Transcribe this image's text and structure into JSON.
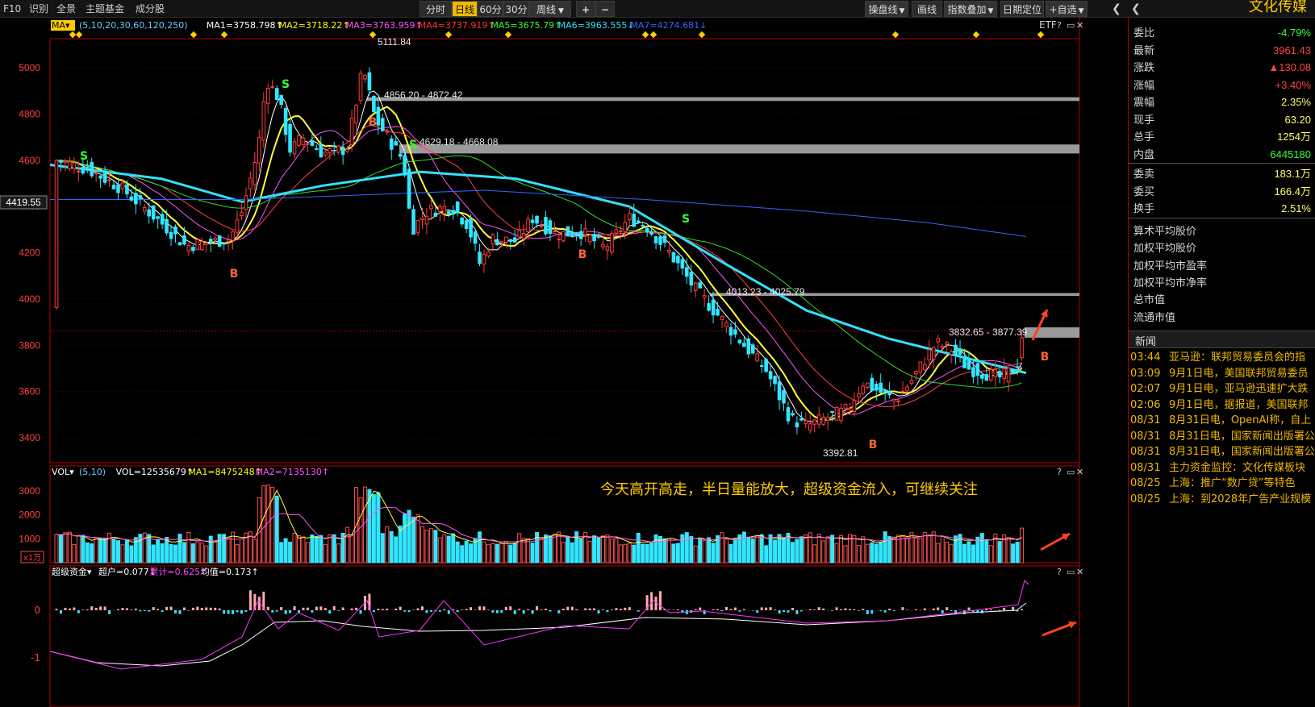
{
  "toolbar": {
    "left": [
      "F10",
      "识别",
      "全景",
      "主题基金",
      "成分股"
    ],
    "periods": [
      "分时",
      "日线",
      "60分",
      "30分",
      "周线"
    ],
    "active_period": "日线",
    "zoom_in": "+",
    "zoom_out": "−",
    "right": [
      "操盘线",
      "画线",
      "指数叠加",
      "日期定位",
      "+自选"
    ],
    "title": "文化传媒"
  },
  "indicator_bars": {
    "ma": {
      "name": "MA",
      "params": "(5,10,20,30,60,120,250)",
      "values": [
        {
          "text": "MA1=3758.798↑",
          "color": "#ffffff"
        },
        {
          "text": "MA2=3718.22↑",
          "color": "#ffff00"
        },
        {
          "text": "MA3=3763.959↑",
          "color": "#ff55ff"
        },
        {
          "text": "MA4=3737.919↑",
          "color": "#ff3333"
        },
        {
          "text": "MA5=3675.79↑",
          "color": "#33ff33"
        },
        {
          "text": "MA6=3963.555↓",
          "color": "#33ddff"
        },
        {
          "text": "MA7=4274.681↓",
          "color": "#3366ff"
        }
      ],
      "etf": "ETF"
    },
    "vol": {
      "name": "VOL",
      "params": "(5,10)",
      "values": [
        {
          "text": "VOL=12535679↑",
          "color": "#ffffff"
        },
        {
          "text": "MA1=8475248↑",
          "color": "#ffff00"
        },
        {
          "text": "MA2=7135130↑",
          "color": "#ff55ff"
        }
      ]
    },
    "fund": {
      "name": "超级资金",
      "values": [
        {
          "text": "超户=0.077↓",
          "color": "#ffffff"
        },
        {
          "text": "累计=0.625↑",
          "color": "#ff44ff"
        },
        {
          "text": "均值=0.173↑",
          "color": "#ffffff"
        }
      ]
    }
  },
  "chart_data": {
    "type": "candlestick",
    "y_axis_ticks": [
      5000,
      4800,
      4600,
      4400,
      4200,
      4000,
      3800,
      3600,
      3400
    ],
    "ylim": [
      3350,
      5200
    ],
    "current_price_label": "4419.55",
    "price_annotations": [
      {
        "text": "5111.84",
        "price": 5111.84
      },
      {
        "text": "4856.20 - 4872.42",
        "price": 4872.42
      },
      {
        "text": "4629.18 - 4668.08",
        "price": 4668.08
      },
      {
        "text": "4013.23 - 4025.79",
        "price": 4025.79
      },
      {
        "text": "3832.65 - 3877.39",
        "price": 3877.39
      },
      {
        "text": "3392.81",
        "price": 3392.81
      }
    ],
    "resistance_zones": [
      {
        "low": 4856.2,
        "high": 4872.42
      },
      {
        "low": 4629.18,
        "high": 4668.08
      },
      {
        "low": 4013.23,
        "high": 4025.79
      },
      {
        "low": 3832.65,
        "high": 3877.39
      }
    ],
    "signals": [
      "S",
      "B",
      "S",
      "B",
      "S",
      "B",
      "S",
      "B",
      "B"
    ],
    "vol_ticks": [
      3000,
      2000,
      1000
    ],
    "vol_unit": "x1万",
    "fund_ticks": [
      "0",
      "-1"
    ],
    "annotation_text": "今天高开高走，半日量能放大，超级资金流入，可继续关注"
  },
  "quote": {
    "rows": [
      {
        "label": "委比",
        "value": "-4.79%",
        "color": "#33ff33"
      },
      {
        "label": "最新",
        "value": "3961.43",
        "color": "#ff4444"
      },
      {
        "label": "涨跌",
        "value": "▲130.08",
        "color": "#ff4444"
      },
      {
        "label": "涨幅",
        "value": "+3.40%",
        "color": "#ff4444"
      },
      {
        "label": "震幅",
        "value": "2.35%",
        "color": "#ffff66"
      },
      {
        "label": "现手",
        "value": "63.20",
        "color": "#ffff66"
      },
      {
        "label": "总手",
        "value": "1254万",
        "color": "#ffff66"
      },
      {
        "label": "内盘",
        "value": "6445180",
        "color": "#33ff33"
      },
      {
        "label": "委卖",
        "value": "183.1万",
        "color": "#ffff66"
      },
      {
        "label": "委买",
        "value": "166.4万",
        "color": "#ffff66"
      },
      {
        "label": "换手",
        "value": "2.51%",
        "color": "#ffff66"
      }
    ],
    "links": [
      "算术平均股价",
      "加权平均股价",
      "加权平均市盈率",
      "加权平均市净率",
      "总市值",
      "流通市值"
    ]
  },
  "news": {
    "title": "新闻",
    "items": [
      {
        "time": "03:44",
        "headline": "亚马逊：联邦贸易委员会的指"
      },
      {
        "time": "03:09",
        "headline": "9月1日电，美国联邦贸易委员"
      },
      {
        "time": "02:07",
        "headline": "9月1日电，亚马逊迅速扩大跌"
      },
      {
        "time": "02:06",
        "headline": "9月1日电，据报道，美国联邦"
      },
      {
        "time": "08/31",
        "headline": "8月31日电，OpenAI称，自上"
      },
      {
        "time": "08/31",
        "headline": "8月31日电，国家新闻出版署公"
      },
      {
        "time": "08/31",
        "headline": "8月31日电，国家新闻出版署公"
      },
      {
        "time": "08/31",
        "headline": "主力资金监控：文化传媒板块"
      },
      {
        "time": "08/25",
        "headline": "上海：推广“数广贷”等特色"
      },
      {
        "time": "08/25",
        "headline": "上海：到2028年广告产业规模"
      }
    ]
  }
}
